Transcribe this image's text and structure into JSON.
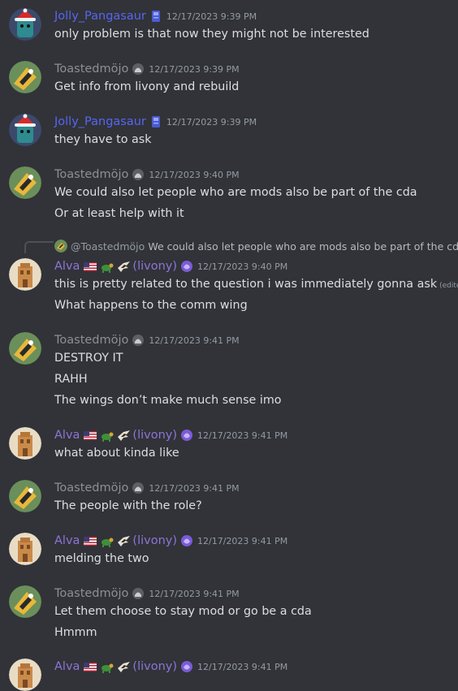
{
  "users": {
    "jolly": {
      "name": "Jolly_Pangasaur",
      "color": "#5865f2"
    },
    "toast": {
      "name": "Toastedmöjo",
      "color": "#8b8f96"
    },
    "alva": {
      "name": "Alva",
      "suffix": "(livony)",
      "color": "#8e74d6"
    }
  },
  "reply": {
    "author": "@Toastedmöjo",
    "text": "We could also let people who are mods also be part of the cda"
  },
  "messages": [
    {
      "author": "jolly",
      "timestamp": "12/17/2023 9:39 PM",
      "lines": [
        "only problem is that now they might not be interested"
      ]
    },
    {
      "author": "toast",
      "timestamp": "12/17/2023 9:39 PM",
      "lines": [
        "Get info from livony and rebuild"
      ]
    },
    {
      "author": "jolly",
      "timestamp": "12/17/2023 9:39 PM",
      "lines": [
        "they have to ask"
      ]
    },
    {
      "author": "toast",
      "timestamp": "12/17/2023 9:40 PM",
      "lines": [
        "We could also let people who are mods also be part of the cda",
        "Or at least help with it"
      ]
    },
    {
      "author": "alva",
      "timestamp": "12/17/2023 9:40 PM",
      "lines": [
        "this is pretty related to the question i was immediately gonna ask",
        "What happens to the comm wing"
      ],
      "edited": "(edited)"
    },
    {
      "author": "toast",
      "timestamp": "12/17/2023 9:41 PM",
      "lines": [
        "DESTROY IT",
        "RAHH",
        "The wings don’t make much sense imo"
      ]
    },
    {
      "author": "alva",
      "timestamp": "12/17/2023 9:41 PM",
      "lines": [
        "what about kinda like"
      ]
    },
    {
      "author": "toast",
      "timestamp": "12/17/2023 9:41 PM",
      "lines": [
        "The people with the role?"
      ]
    },
    {
      "author": "alva",
      "timestamp": "12/17/2023 9:41 PM",
      "lines": [
        "melding the two"
      ]
    },
    {
      "author": "toast",
      "timestamp": "12/17/2023 9:41 PM",
      "lines": [
        "Let them choose to stay mod or go be a cda",
        "Hmmm"
      ]
    },
    {
      "author": "alva",
      "timestamp": "12/17/2023 9:41 PM",
      "lines": []
    }
  ]
}
